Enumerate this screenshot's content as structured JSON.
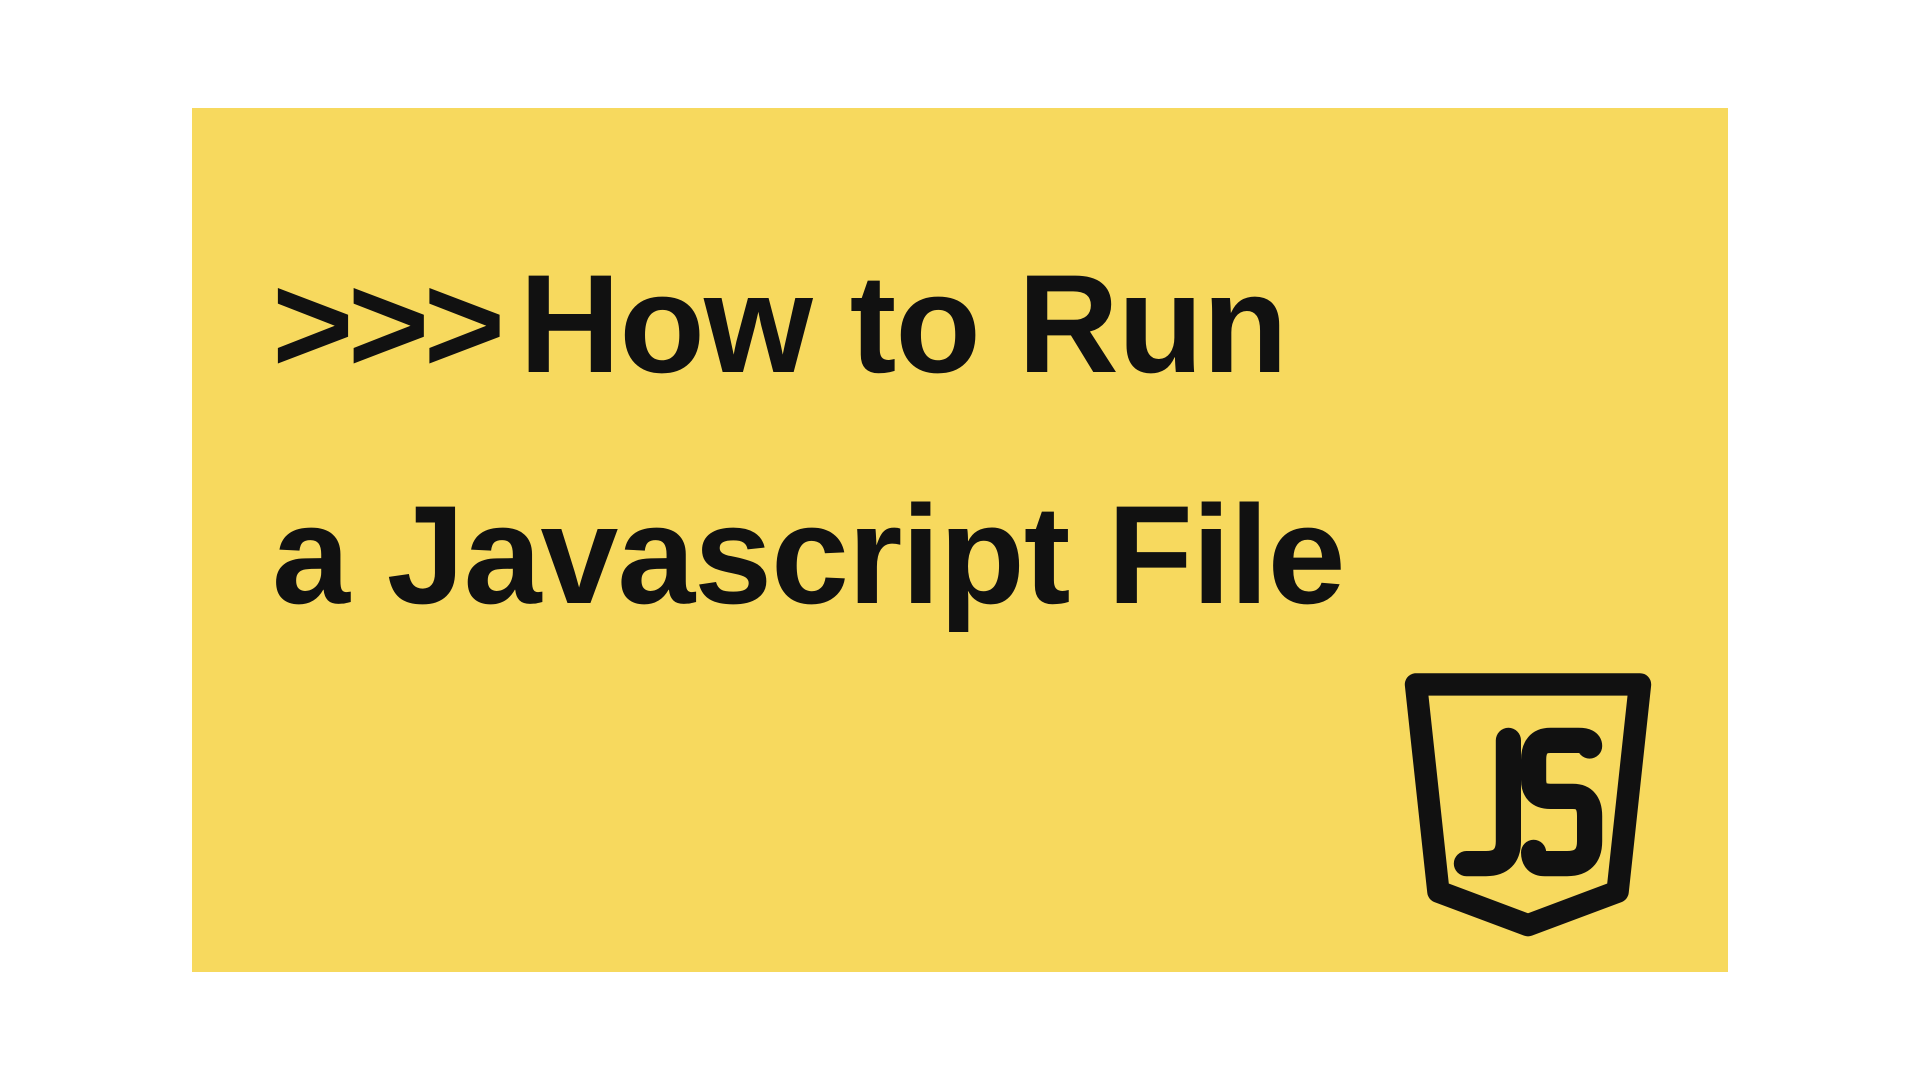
{
  "banner": {
    "prefix": ">>>",
    "title_line1": "How to Run",
    "title_line2": "a Javascript File"
  },
  "colors": {
    "background": "#f7d95e",
    "text": "#111111"
  }
}
